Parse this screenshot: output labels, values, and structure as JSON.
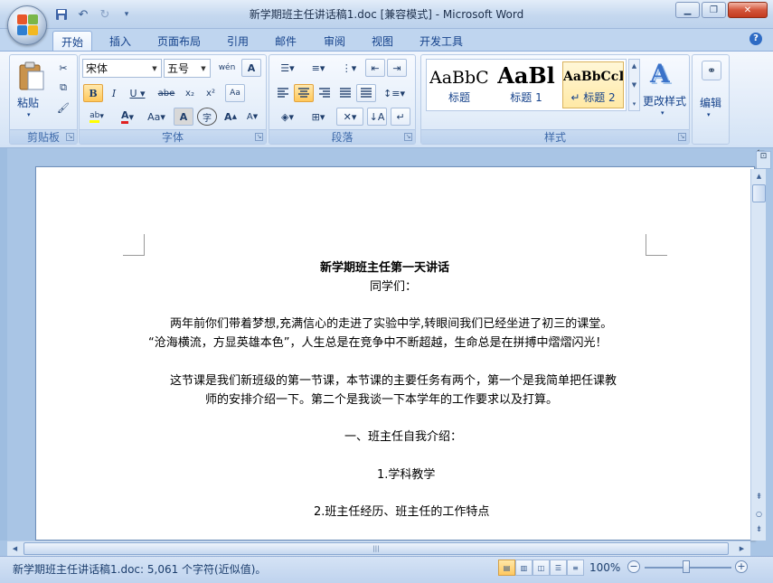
{
  "window": {
    "title": "新学期班主任讲话稿1.doc [兼容模式] - Microsoft Word",
    "minimize_icon": "minimize-icon",
    "maximize_icon": "restore-icon",
    "close_icon": "close-icon"
  },
  "tabs": [
    {
      "label": "开始",
      "active": true
    },
    {
      "label": "插入",
      "active": false
    },
    {
      "label": "页面布局",
      "active": false
    },
    {
      "label": "引用",
      "active": false
    },
    {
      "label": "邮件",
      "active": false
    },
    {
      "label": "审阅",
      "active": false
    },
    {
      "label": "视图",
      "active": false
    },
    {
      "label": "开发工具",
      "active": false
    }
  ],
  "ribbon": {
    "clipboard": {
      "label": "剪贴板",
      "paste_label": "粘贴"
    },
    "font": {
      "label": "字体",
      "font_name": "宋体",
      "font_size": "五号"
    },
    "paragraph": {
      "label": "段落"
    },
    "styles": {
      "label": "样式",
      "items": [
        {
          "sample": "AaBbC(",
          "name": "标题"
        },
        {
          "sample": "AaBl",
          "name": "标题 1"
        },
        {
          "sample": "AaBbCcI",
          "name": "↵ 标题 2"
        }
      ],
      "change_styles_label": "更改样式"
    },
    "editing": {
      "label": "编辑"
    }
  },
  "document": {
    "title": "新学期班主任第一天讲话",
    "greeting": "同学们：",
    "para1_line1": "两年前你们带着梦想,充满信心的走进了实验中学,转眼间我们已经坐进了初三的课堂。",
    "para1_line2": "“沧海横流，方显英雄本色”，人生总是在竞争中不断超越，生命总是在拼搏中熠熠闪光！",
    "para2_line1": "这节课是我们新班级的第一节课，本节课的主要任务有两个，第一个是我简单把任课教",
    "para2_line2": "师的安排介绍一下。第二个是我谈一下本学年的工作要求以及打算。",
    "section1": "一、班主任自我介绍：",
    "item1": "1.学科教学",
    "item2": "2.班主任经历、班主任的工作特点"
  },
  "statusbar": {
    "doc_info": "新学期班主任讲话稿1.doc: 5,061 个字符(近似值)。",
    "zoom": "100%"
  }
}
